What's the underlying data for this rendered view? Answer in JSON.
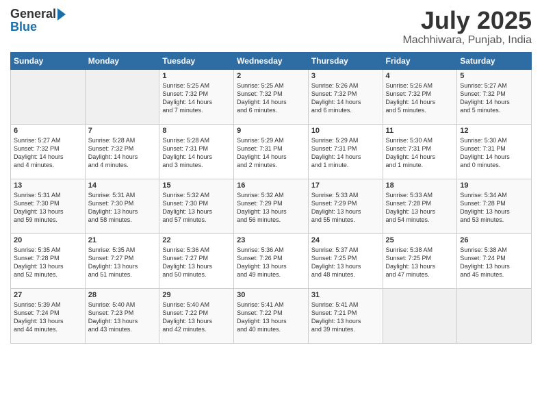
{
  "header": {
    "logo_general": "General",
    "logo_blue": "Blue",
    "month_title": "July 2025",
    "location": "Machhiwara, Punjab, India"
  },
  "weekdays": [
    "Sunday",
    "Monday",
    "Tuesday",
    "Wednesday",
    "Thursday",
    "Friday",
    "Saturday"
  ],
  "weeks": [
    [
      {
        "day": "",
        "content": ""
      },
      {
        "day": "",
        "content": ""
      },
      {
        "day": "1",
        "content": "Sunrise: 5:25 AM\nSunset: 7:32 PM\nDaylight: 14 hours\nand 7 minutes."
      },
      {
        "day": "2",
        "content": "Sunrise: 5:25 AM\nSunset: 7:32 PM\nDaylight: 14 hours\nand 6 minutes."
      },
      {
        "day": "3",
        "content": "Sunrise: 5:26 AM\nSunset: 7:32 PM\nDaylight: 14 hours\nand 6 minutes."
      },
      {
        "day": "4",
        "content": "Sunrise: 5:26 AM\nSunset: 7:32 PM\nDaylight: 14 hours\nand 5 minutes."
      },
      {
        "day": "5",
        "content": "Sunrise: 5:27 AM\nSunset: 7:32 PM\nDaylight: 14 hours\nand 5 minutes."
      }
    ],
    [
      {
        "day": "6",
        "content": "Sunrise: 5:27 AM\nSunset: 7:32 PM\nDaylight: 14 hours\nand 4 minutes."
      },
      {
        "day": "7",
        "content": "Sunrise: 5:28 AM\nSunset: 7:32 PM\nDaylight: 14 hours\nand 4 minutes."
      },
      {
        "day": "8",
        "content": "Sunrise: 5:28 AM\nSunset: 7:31 PM\nDaylight: 14 hours\nand 3 minutes."
      },
      {
        "day": "9",
        "content": "Sunrise: 5:29 AM\nSunset: 7:31 PM\nDaylight: 14 hours\nand 2 minutes."
      },
      {
        "day": "10",
        "content": "Sunrise: 5:29 AM\nSunset: 7:31 PM\nDaylight: 14 hours\nand 1 minute."
      },
      {
        "day": "11",
        "content": "Sunrise: 5:30 AM\nSunset: 7:31 PM\nDaylight: 14 hours\nand 1 minute."
      },
      {
        "day": "12",
        "content": "Sunrise: 5:30 AM\nSunset: 7:31 PM\nDaylight: 14 hours\nand 0 minutes."
      }
    ],
    [
      {
        "day": "13",
        "content": "Sunrise: 5:31 AM\nSunset: 7:30 PM\nDaylight: 13 hours\nand 59 minutes."
      },
      {
        "day": "14",
        "content": "Sunrise: 5:31 AM\nSunset: 7:30 PM\nDaylight: 13 hours\nand 58 minutes."
      },
      {
        "day": "15",
        "content": "Sunrise: 5:32 AM\nSunset: 7:30 PM\nDaylight: 13 hours\nand 57 minutes."
      },
      {
        "day": "16",
        "content": "Sunrise: 5:32 AM\nSunset: 7:29 PM\nDaylight: 13 hours\nand 56 minutes."
      },
      {
        "day": "17",
        "content": "Sunrise: 5:33 AM\nSunset: 7:29 PM\nDaylight: 13 hours\nand 55 minutes."
      },
      {
        "day": "18",
        "content": "Sunrise: 5:33 AM\nSunset: 7:28 PM\nDaylight: 13 hours\nand 54 minutes."
      },
      {
        "day": "19",
        "content": "Sunrise: 5:34 AM\nSunset: 7:28 PM\nDaylight: 13 hours\nand 53 minutes."
      }
    ],
    [
      {
        "day": "20",
        "content": "Sunrise: 5:35 AM\nSunset: 7:28 PM\nDaylight: 13 hours\nand 52 minutes."
      },
      {
        "day": "21",
        "content": "Sunrise: 5:35 AM\nSunset: 7:27 PM\nDaylight: 13 hours\nand 51 minutes."
      },
      {
        "day": "22",
        "content": "Sunrise: 5:36 AM\nSunset: 7:27 PM\nDaylight: 13 hours\nand 50 minutes."
      },
      {
        "day": "23",
        "content": "Sunrise: 5:36 AM\nSunset: 7:26 PM\nDaylight: 13 hours\nand 49 minutes."
      },
      {
        "day": "24",
        "content": "Sunrise: 5:37 AM\nSunset: 7:25 PM\nDaylight: 13 hours\nand 48 minutes."
      },
      {
        "day": "25",
        "content": "Sunrise: 5:38 AM\nSunset: 7:25 PM\nDaylight: 13 hours\nand 47 minutes."
      },
      {
        "day": "26",
        "content": "Sunrise: 5:38 AM\nSunset: 7:24 PM\nDaylight: 13 hours\nand 45 minutes."
      }
    ],
    [
      {
        "day": "27",
        "content": "Sunrise: 5:39 AM\nSunset: 7:24 PM\nDaylight: 13 hours\nand 44 minutes."
      },
      {
        "day": "28",
        "content": "Sunrise: 5:40 AM\nSunset: 7:23 PM\nDaylight: 13 hours\nand 43 minutes."
      },
      {
        "day": "29",
        "content": "Sunrise: 5:40 AM\nSunset: 7:22 PM\nDaylight: 13 hours\nand 42 minutes."
      },
      {
        "day": "30",
        "content": "Sunrise: 5:41 AM\nSunset: 7:22 PM\nDaylight: 13 hours\nand 40 minutes."
      },
      {
        "day": "31",
        "content": "Sunrise: 5:41 AM\nSunset: 7:21 PM\nDaylight: 13 hours\nand 39 minutes."
      },
      {
        "day": "",
        "content": ""
      },
      {
        "day": "",
        "content": ""
      }
    ]
  ]
}
